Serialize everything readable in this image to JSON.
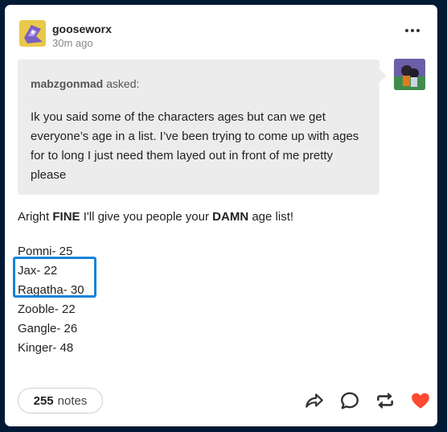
{
  "post": {
    "blog_name": "gooseworx",
    "time_ago": "30m ago",
    "more_icon": "ellipsis-icon"
  },
  "ask": {
    "asker": "mabzgonmad",
    "asked_label": "asked:",
    "question": "Ik you said some of the characters ages but can we get everyone’s age in a list. I’ve been trying to come up with ages for to long I just need them layed out in front of me pretty please"
  },
  "answer": {
    "intro_before": "Aright ",
    "intro_bold1": "FINE",
    "intro_middle": " I'll give you people your ",
    "intro_bold2": "DAMN",
    "intro_after": " age list!",
    "ages": [
      "Pomni- 25",
      "Jax- 22",
      "Ragatha- 30",
      "Zooble- 22",
      "Gangle- 26",
      "Kinger- 48"
    ]
  },
  "footer": {
    "notes_count": "255",
    "notes_label": "notes",
    "icons": [
      "share-icon",
      "reply-icon",
      "reblog-icon",
      "like-heart-icon"
    ],
    "like_color": "#ff4930"
  }
}
